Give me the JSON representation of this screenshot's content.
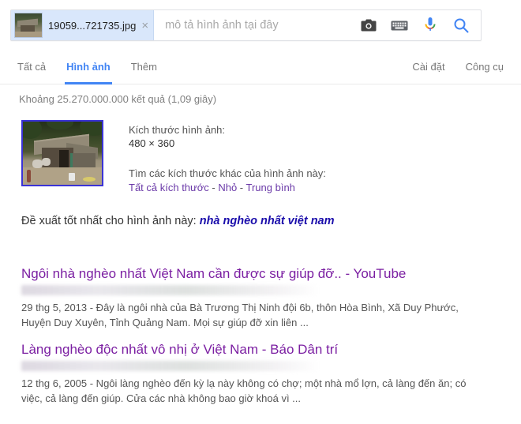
{
  "search": {
    "file_chip_name": "19059...721735.jpg",
    "file_chip_close": "×",
    "placeholder": "mô tả hình ảnh tại đây",
    "value": "",
    "icons": [
      "camera-icon",
      "keyboard-icon",
      "microphone-icon",
      "search-icon"
    ]
  },
  "tabs": {
    "left": [
      {
        "label": "Tất cả",
        "active": false
      },
      {
        "label": "Hình ảnh",
        "active": true
      },
      {
        "label": "Thêm",
        "active": false
      }
    ],
    "right": [
      {
        "label": "Cài đặt"
      },
      {
        "label": "Công cụ"
      }
    ]
  },
  "stats": "Khoảng 25.270.000.000 kết quả (1,09 giây)",
  "image_info": {
    "size_label": "Kích thước hình ảnh:",
    "dimensions": "480 × 360",
    "other_sizes_label": "Tìm các kích thước khác của hình ảnh này:",
    "size_links": [
      "Tất cả kích thước",
      "Nhỏ",
      "Trung bình"
    ],
    "separator": " - "
  },
  "best_guess": {
    "label": "Đề xuất tốt nhất cho hình ảnh này:",
    "query": "nhà nghèo nhất việt nam"
  },
  "results": [
    {
      "title": "Ngôi nhà nghèo nhất Việt Nam cần được sự giúp đỡ.. - YouTube",
      "url_redacted": true,
      "date": "29 thg 5, 2013",
      "snippet": "29 thg 5, 2013 - Đây là ngôi nhà của Bà Trương Thị Ninh đội 6b, thôn Hòa Bình, Xã Duy Phước, Huyện Duy Xuyên, Tỉnh Quảng Nam. Mọi sự giúp đỡ xin liên ..."
    },
    {
      "title": "Làng nghèo độc nhất vô nhị ở Việt Nam - Báo Dân trí",
      "url_redacted": true,
      "date": "12 thg 6, 2005",
      "snippet": "12 thg 6, 2005 - Ngôi làng nghèo đến kỳ lạ này không có chợ; một nhà mổ lợn, cả làng đến ăn; có việc, cả làng đến giúp. Cửa các nhà không bao giờ khoá vì ..."
    }
  ],
  "colors": {
    "google_blue": "#4285f4",
    "link_blue": "#1a0dab",
    "visited_purple": "#7b1fa2",
    "chip_bg": "#d9e7fb"
  }
}
